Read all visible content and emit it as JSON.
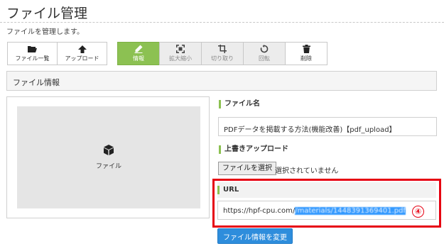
{
  "page": {
    "title": "ファイル管理",
    "description": "ファイルを管理します。"
  },
  "toolbar": {
    "left": [
      {
        "label": "ファイル一覧",
        "icon": "folder-icon"
      },
      {
        "label": "アップロード",
        "icon": "upload-icon"
      }
    ],
    "right": [
      {
        "label": "情報",
        "icon": "edit-icon",
        "state": "active"
      },
      {
        "label": "拡大縮小",
        "icon": "resize-icon",
        "state": "disabled"
      },
      {
        "label": "切り取り",
        "icon": "crop-icon",
        "state": "disabled"
      },
      {
        "label": "回転",
        "icon": "rotate-icon",
        "state": "disabled"
      },
      {
        "label": "削除",
        "icon": "trash-icon",
        "state": "normal"
      }
    ]
  },
  "section": {
    "title": "ファイル情報"
  },
  "preview": {
    "label": "ファイル",
    "icon": "cube-icon"
  },
  "fields": {
    "filename_label": "ファイル名",
    "filename_value": "PDFデータを掲載する方法(機能改善)【pdf_upload】",
    "overwrite_label": "上書きアップロード",
    "choose_file_button": "ファイルを選択",
    "file_status": "選択されていません",
    "url_label": "URL",
    "url_prefix": "https://hpf-cpu.com/",
    "url_hidden": "/materials/1448391369401.pdf"
  },
  "annotation": {
    "marker": "④"
  },
  "submit_button": "ファイル情報を変更",
  "colors": {
    "active_green": "#8cc152",
    "accent_blue": "#2e8ddc",
    "highlight_red": "#e60012"
  }
}
